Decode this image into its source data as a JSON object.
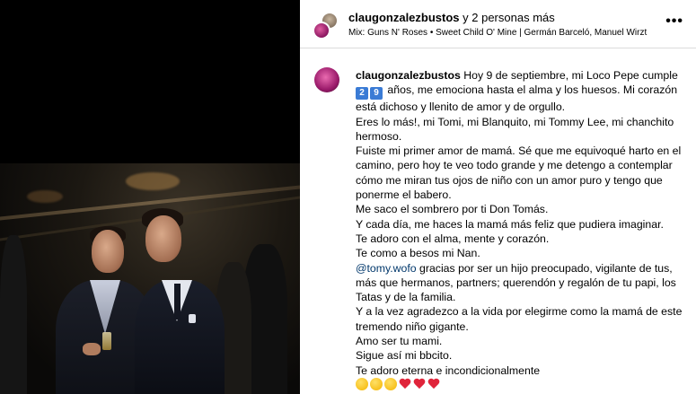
{
  "header": {
    "username": "claugonzalezbustos",
    "collaborators": " y 2 personas más",
    "audio": "Mix: Guns N' Roses • Sweet Child O' Mine | Germán Barceló, Manuel Wirzt",
    "more_icon": "more-horizontal-icon"
  },
  "caption": {
    "username": "claugonzalezbustos",
    "line1": "Hoy 9 de septiembre, mi Loco Pepe cumple",
    "age_digits": [
      "2",
      "9"
    ],
    "line2": "años, me emociona hasta el alma y los huesos. Mi corazón está dichoso y llenito de amor y de orgullo.",
    "line3": "Eres lo más!, mi Tomi, mi Blanquito, mi Tommy Lee, mi chanchito hermoso.",
    "line4": "Fuiste mi primer amor de mamá. Sé que me equivoqué harto en el camino, pero hoy te veo todo grande y me detengo a contemplar cómo me miran tus ojos de niño con un amor puro y tengo que ponerme el babero.",
    "line5": "Me saco el sombrero por ti Don Tomás.",
    "line6": "Y cada día, me haces la mamá más feliz que pudiera imaginar.",
    "line7": "Te adoro con el alma, mente y corazón.",
    "line8": "Te como a besos mi Nan.",
    "mention": "@tomy.wofo",
    "line9": " gracias por ser un hijo preocupado, vigilante de tus, más que hermanos, partners; querendón y regalón de tu papi, los Tatas y de la familia.",
    "line10": "Y a la vez agradezco a la vida por elegirme como la mamá de este tremendo niño gigante.",
    "line11": "Amo ser tu mami.",
    "line12": "Sigue así mi bbcito.",
    "line13": "Te adoro eterna e incondicionalmente",
    "emojis": [
      "heart-eyes-emoji",
      "kiss-emoji",
      "smiling-hearts-emoji",
      "red-heart-emoji",
      "two-hearts-emoji",
      "broken-heart-emoji"
    ]
  },
  "colors": {
    "mention": "#00376b",
    "border": "#dbdbdb"
  }
}
